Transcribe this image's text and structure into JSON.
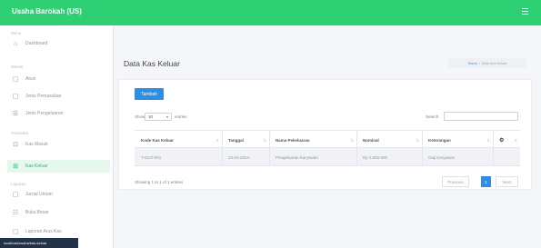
{
  "app": {
    "title": "Usaha Barokah (US)"
  },
  "sidebar": {
    "sections": {
      "main": "Menu",
      "master": "Master",
      "transaksi": "Transaksi",
      "laporan": "Laporan"
    },
    "items": [
      {
        "label": "Dashboard",
        "icon": "home-icon",
        "glyph": "⌂"
      },
      {
        "label": "Akun",
        "icon": "file-icon",
        "glyph": "▢"
      },
      {
        "label": "Jenis Pemasukan",
        "icon": "file-icon",
        "glyph": "▢"
      },
      {
        "label": "Jenis Pengeluaran",
        "icon": "list-icon",
        "glyph": "☰"
      },
      {
        "label": "Kas Masuk",
        "icon": "inbox-icon",
        "glyph": "⊡"
      },
      {
        "label": "Kas Keluar",
        "icon": "grid-icon",
        "glyph": "⊞"
      },
      {
        "label": "Jurnal Umum",
        "icon": "file-icon",
        "glyph": "▢"
      },
      {
        "label": "Buku Besar",
        "icon": "book-icon",
        "glyph": "☷"
      },
      {
        "label": "Laporan Arus Kas",
        "icon": "file-icon",
        "glyph": "▢"
      }
    ],
    "active_index": 5
  },
  "tooltip": "localhost/usaha/kas-keluar",
  "page": {
    "title": "Data Kas Keluar",
    "breadcrumb": {
      "home": "Home",
      "separator": "/",
      "current": "Data Kas Keluar"
    }
  },
  "toolbar": {
    "add_label": "Tambah"
  },
  "datatable": {
    "show_label": "Show",
    "entries_label": "entries",
    "length_value": "10",
    "search_label": "Search:",
    "search_value": "",
    "columns": [
      "Kode Kas Keluar",
      "Tanggal",
      "Nama Pekeluaran",
      "Nominal",
      "Keterangan",
      "⚙"
    ],
    "rows": [
      [
        "T-OUT-001",
        "23-01-2024",
        "Pengeluaran Karyawan",
        "Rp 3.000.000",
        "Gaji Karyawan",
        ""
      ]
    ],
    "info": "Showing 1 to 1 of 1 entries",
    "pagination": {
      "previous": "Previous",
      "current": "1",
      "next": "Next"
    }
  }
}
